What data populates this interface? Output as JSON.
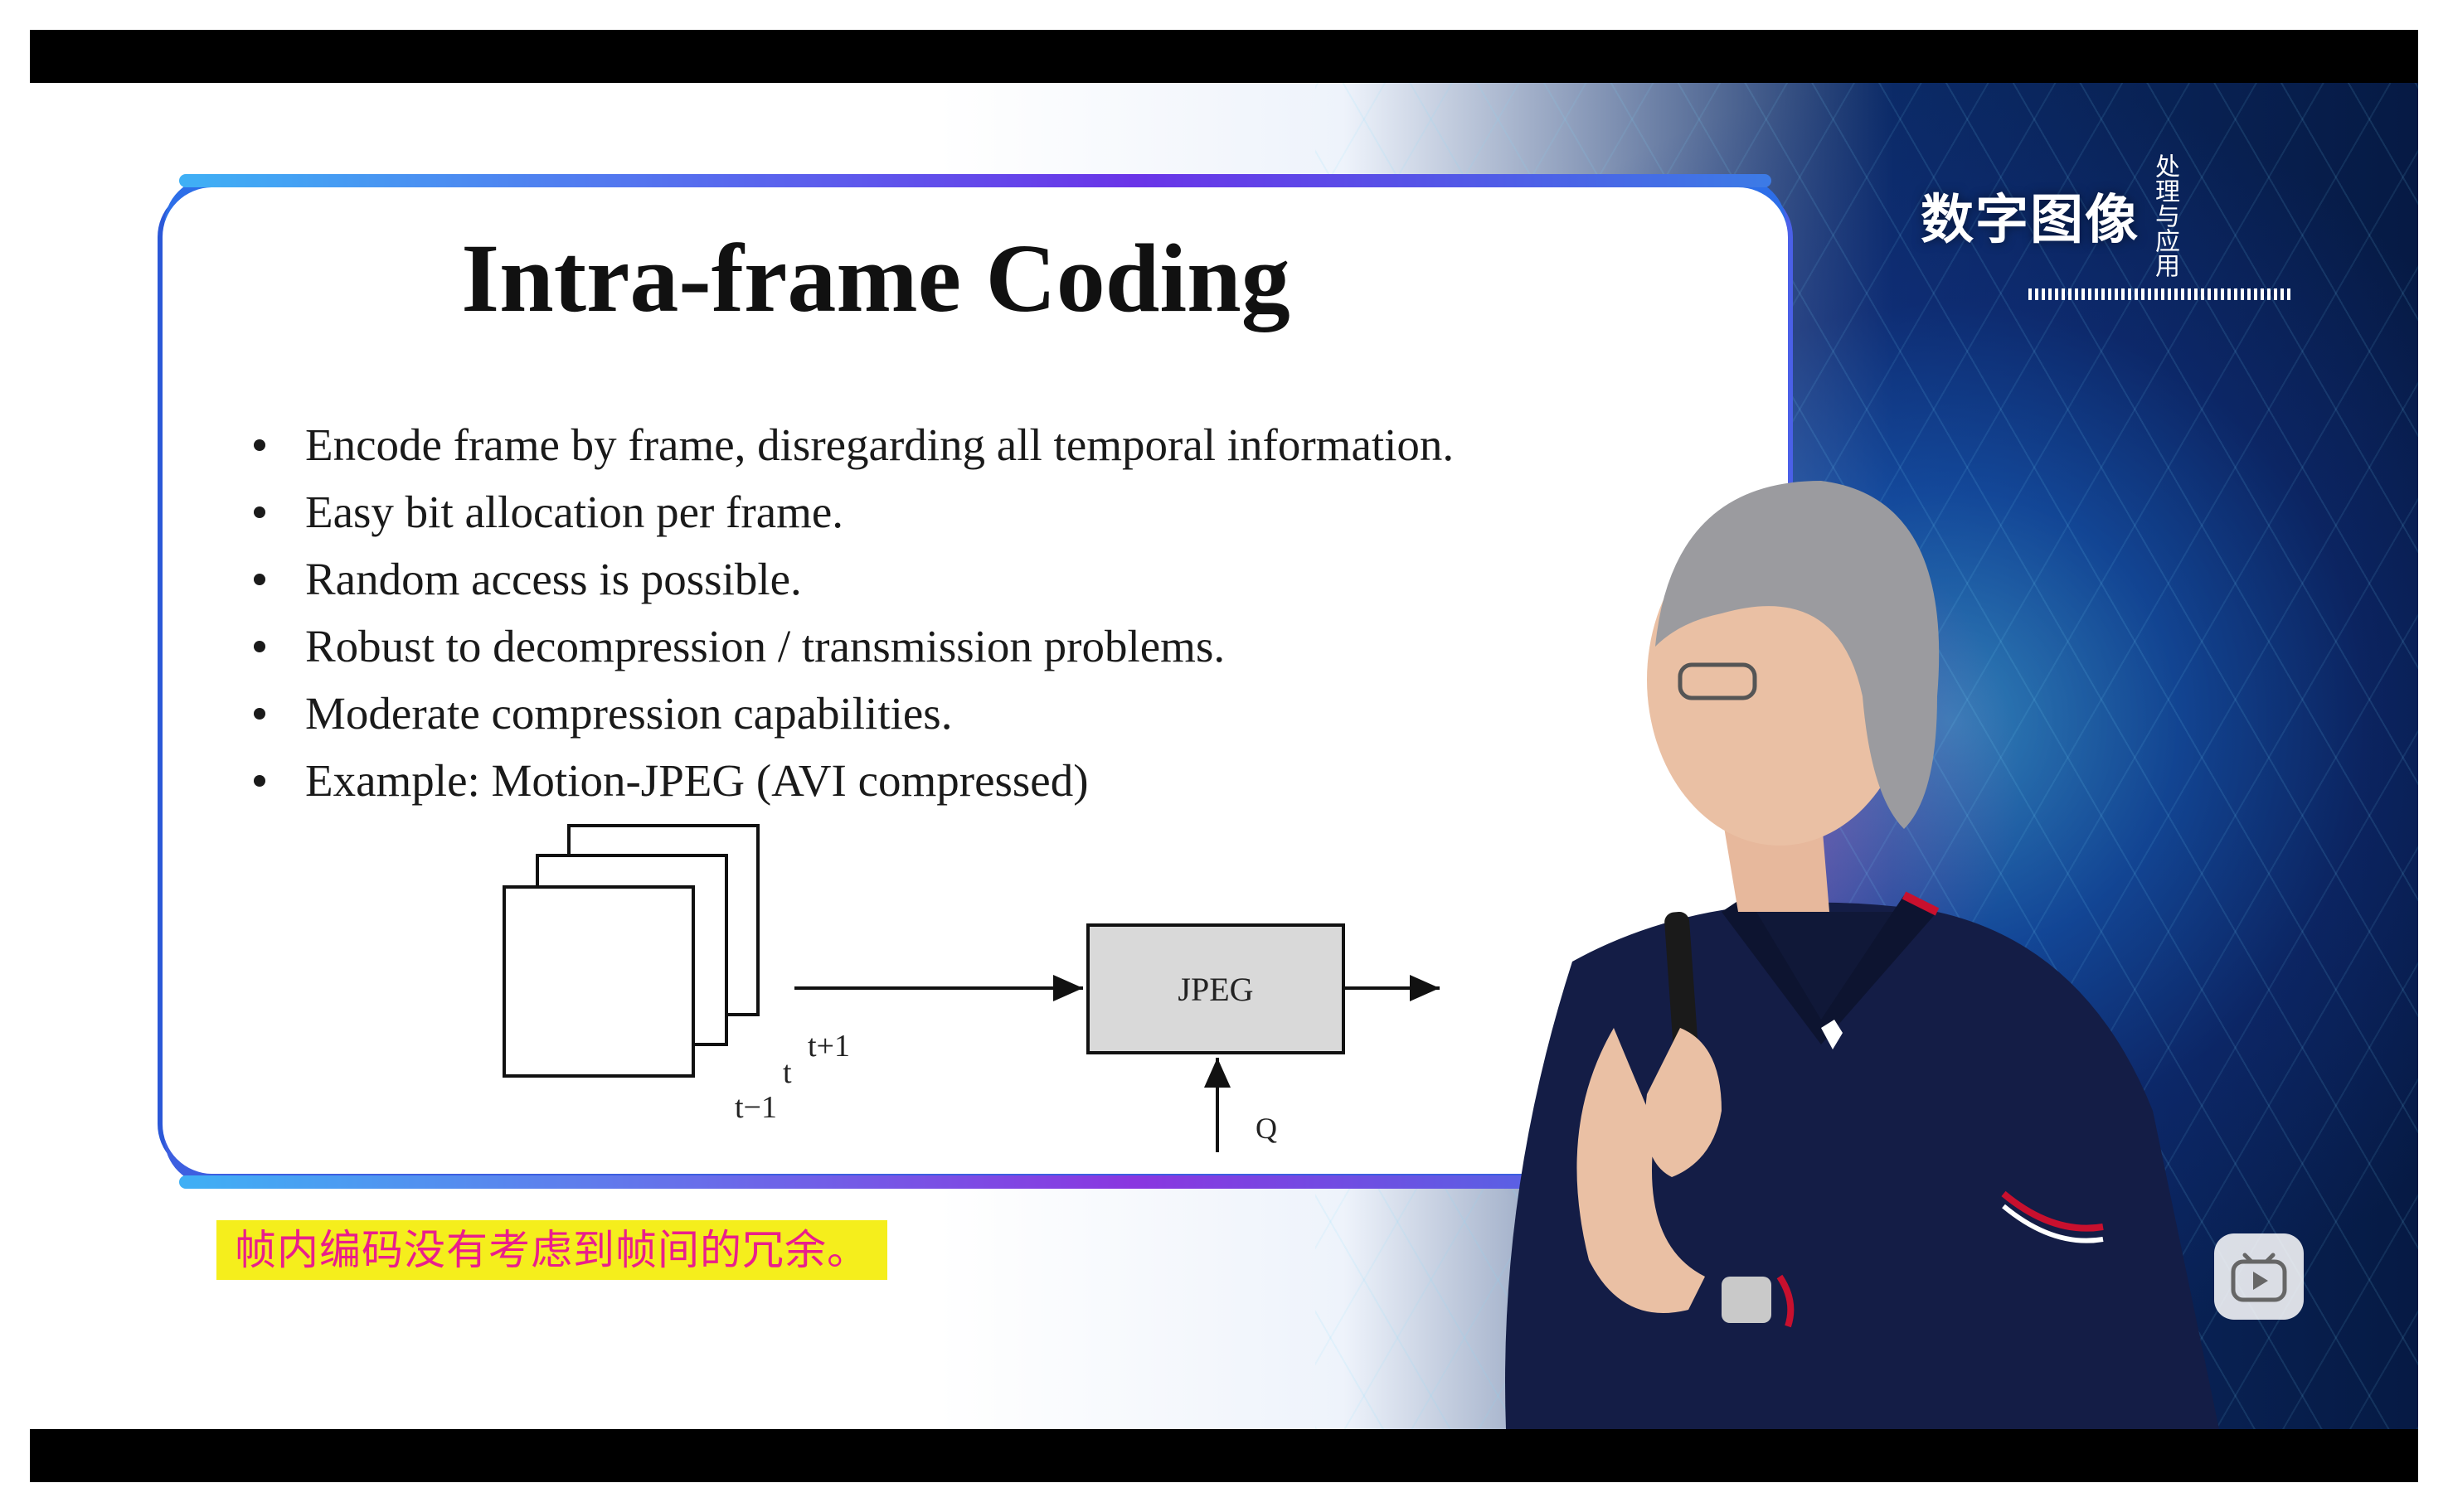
{
  "slide": {
    "title": "Intra-frame Coding",
    "bullets": [
      "Encode frame by frame, disregarding all temporal information.",
      "Easy bit allocation per frame.",
      "Random access is possible.",
      "Robust to decompression / transmission problems.",
      "Moderate compression capabilities.",
      "Example: Motion-JPEG (AVI compressed)"
    ],
    "diagram": {
      "block_label": "JPEG",
      "frame_labels": {
        "prev": "t−1",
        "curr": "t",
        "next": "t+1"
      },
      "input_label": "Q"
    }
  },
  "logo": {
    "brand": "数字图像",
    "side_text": "处理与应用"
  },
  "subtitle": "帧内编码没有考虑到帧间的冗余。",
  "controls": {
    "play_icon": "bilibili-play-icon"
  },
  "colors": {
    "subtitle_bg": "#f5ee1c",
    "subtitle_text": "#e91e8c",
    "slide_border": "#3c5fe0",
    "letterbox": "#000000"
  }
}
